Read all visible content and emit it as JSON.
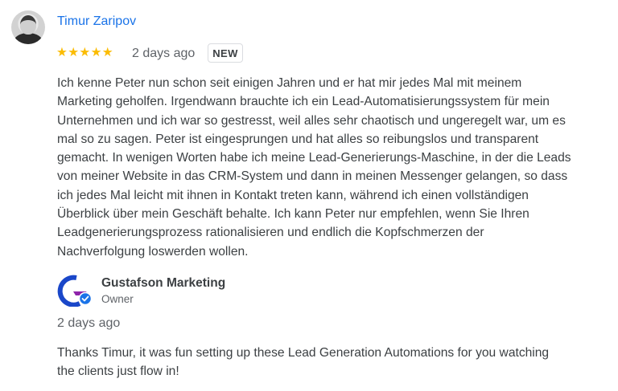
{
  "review": {
    "reviewer_name": "Timur Zaripov",
    "rating": 5,
    "stars": "★★★★★",
    "date": "2 days ago",
    "badge": "NEW",
    "text": "Ich kenne Peter nun schon seit einigen Jahren und er hat mir jedes Mal mit meinem\nMarketing geholfen. Irgendwann brauchte ich ein Lead-Automatisierungssystem für mein\nUnternehmen und ich war so gestresst, weil alles sehr chaotisch und ungeregelt war, um es\nmal so zu sagen. Peter ist eingesprungen und hat alles so reibungslos und transparent\ngemacht. In wenigen Worten habe ich meine Lead-Generierungs-Maschine, in der die Leads\nvon meiner Website in das CRM-System und dann in meinen Messenger gelangen, so dass\nich jedes Mal leicht mit ihnen in Kontakt treten kann, während ich einen vollständigen\nÜberblick über mein Geschäft behalte. Ich kann Peter nur empfehlen, wenn Sie Ihren\nLeadgenerierungsprozess rationalisieren und endlich die Kopfschmerzen der\nNachverfolgung loswerden wollen."
  },
  "reply": {
    "owner_name": "Gustafson Marketing",
    "owner_role": "Owner",
    "date": "2 days ago",
    "text": "Thanks Timur, it was fun setting up these Lead Generation Automations for you watching\nthe clients just flow in!"
  },
  "colors": {
    "reviewer_link": "#1a73e8",
    "star": "#fbbc04",
    "logo_blue": "#1a47c9",
    "logo_purple": "#8e24aa",
    "verified_badge": "#1a73e8"
  }
}
